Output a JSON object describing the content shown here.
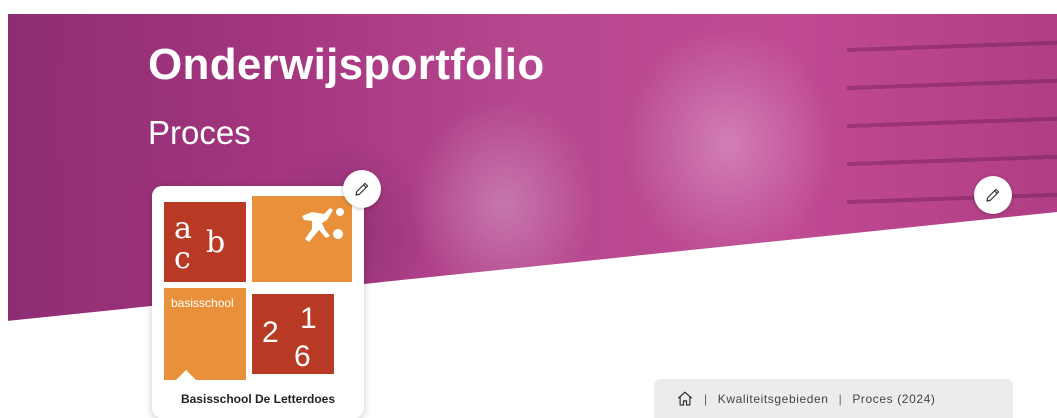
{
  "hero": {
    "title": "Onderwijsportfolio",
    "subtitle": "Proces"
  },
  "school": {
    "name": "Basisschool De Letterdoes",
    "logo": {
      "letters_a": "a",
      "letters_b": "b",
      "letters_c": "c",
      "label": "basisschool",
      "digit_2": "2",
      "digit_1": "1",
      "digit_6": "6",
      "colors": {
        "red": "#b83a24",
        "orange": "#e8913a"
      }
    }
  },
  "breadcrumb": {
    "home_icon": "home-icon",
    "separator": "|",
    "items": [
      "Kwaliteitsgebieden",
      "Proces (2024)"
    ]
  },
  "icons": {
    "edit": "pencil-icon"
  },
  "colors": {
    "hero_overlay": "#a8398a",
    "breadcrumb_bg": "#ececec"
  }
}
